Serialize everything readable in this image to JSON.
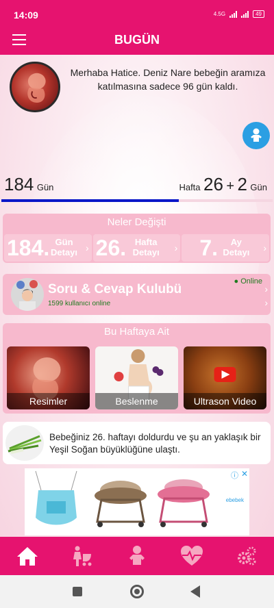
{
  "status": {
    "time": "14:09",
    "network": "4.5G",
    "battery": "49"
  },
  "header": {
    "title": "BUGÜN"
  },
  "greeting": {
    "text": "Merhaba Hatice. Deniz Nare  bebeğin aramıza katılmasına sadece 96 gün kaldı."
  },
  "counts": {
    "days_value": "184",
    "days_unit": "Gün",
    "week_prefix": "Hafta",
    "week_value": "26",
    "plus": "+",
    "extra_days": "2",
    "extra_unit": "Gün",
    "progress": 0.655
  },
  "changed": {
    "title": "Neler Değişti",
    "tiles": [
      {
        "num": "184.",
        "line1": "Gün",
        "line2": "Detayı"
      },
      {
        "num": "26.",
        "line1": "Hafta",
        "line2": "Detayı"
      },
      {
        "num": "7.",
        "line1": "Ay",
        "line2": "Detayı"
      }
    ]
  },
  "qa": {
    "title": "Soru & Cevap Kulubü",
    "subtitle": "1599 kullanıcı online",
    "online": "● Online"
  },
  "week": {
    "title": "Bu Haftaya Ait",
    "tiles": [
      {
        "label": "Resimler"
      },
      {
        "label": "Beslenme"
      },
      {
        "label": "Ultrason Video"
      }
    ]
  },
  "size_info": {
    "text": "Bebeğiniz 26. haftayı doldurdu ve şu an yaklaşık bir Yeşil Soğan büyüklüğüne ulaştı."
  },
  "ad": {
    "brand": "ebebek"
  },
  "tabs": [
    {
      "icon": "home-icon"
    },
    {
      "icon": "mother-stroller-icon"
    },
    {
      "icon": "baby-icon"
    },
    {
      "icon": "heart-pulse-icon"
    },
    {
      "icon": "settings-icon"
    }
  ],
  "colors": {
    "primary": "#e6136f",
    "card": "#f7b9cd",
    "progress": "#0a17c8",
    "accent_blue": "#2b9fe3"
  }
}
